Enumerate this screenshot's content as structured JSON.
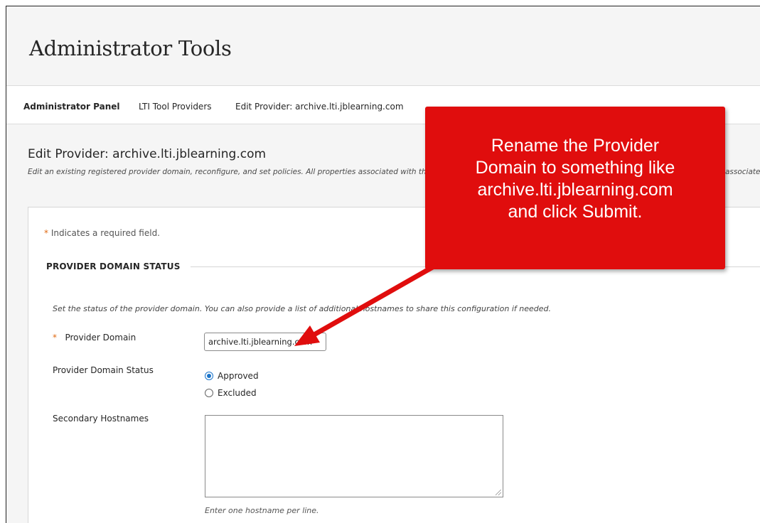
{
  "header": {
    "title": "Administrator Tools"
  },
  "breadcrumbs": [
    {
      "label": "Administrator Panel"
    },
    {
      "label": "LTI Tool Providers"
    },
    {
      "label": "Edit Provider: archive.lti.jblearning.com"
    }
  ],
  "page": {
    "heading": "Edit Provider: archive.lti.jblearning.com",
    "description": "Edit an existing registered provider domain, reconfigure, and set policies. All properties associated with this provider domain can be edited. Any changes made will be applied to all links associated with this provider domain."
  },
  "form": {
    "required_note_star": "*",
    "required_note": "Indicates a required field.",
    "section_title": "PROVIDER DOMAIN STATUS",
    "section_desc": "Set the status of the provider domain. You can also provide a list of additional hostnames to share this configuration if needed.",
    "provider_domain": {
      "star": "*",
      "label": "Provider Domain",
      "value": "archive.lti.jblearning.com"
    },
    "status": {
      "label": "Provider Domain Status",
      "options": [
        {
          "label": "Approved",
          "selected": true
        },
        {
          "label": "Excluded",
          "selected": false
        }
      ]
    },
    "secondary_hostnames": {
      "label": "Secondary Hostnames",
      "value": "",
      "hint": "Enter one hostname per line."
    }
  },
  "callout": {
    "lines": [
      "Rename the Provider",
      "Domain to something like",
      "archive.lti.jblearning.com",
      "and click Submit."
    ],
    "color": "#e00d0d"
  },
  "colors": {
    "accent_radio": "#1a73c9",
    "required_star": "#e06a12"
  }
}
